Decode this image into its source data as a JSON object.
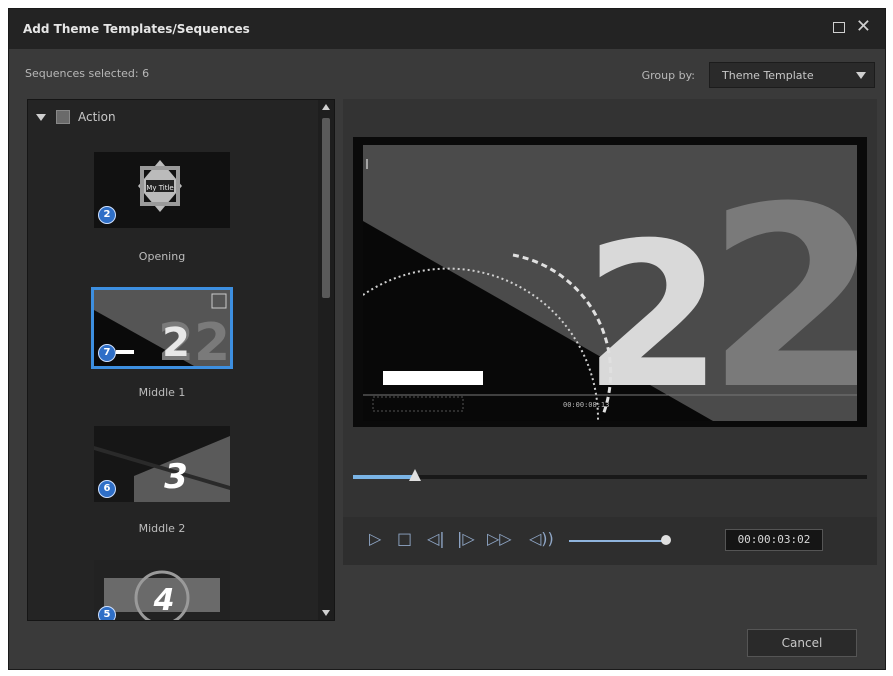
{
  "window": {
    "title": "Add Theme Templates/Sequences"
  },
  "header": {
    "sequences_selected": "Sequences selected: 6",
    "group_by_label": "Group by:",
    "group_by_value": "Theme Template"
  },
  "list": {
    "group_name": "Action",
    "items": [
      {
        "label": "Opening",
        "badge": "2",
        "thumb_text": "My Title"
      },
      {
        "label": "Middle 1",
        "badge": "7",
        "thumb_text": "22"
      },
      {
        "label": "Middle 2",
        "badge": "6",
        "thumb_text": "3"
      },
      {
        "label": "",
        "badge": "5",
        "thumb_text": "4"
      }
    ]
  },
  "preview": {
    "big_number": "2",
    "small_timecode": "00:00:08:13",
    "progress": 0.12,
    "volume": 0.9
  },
  "player": {
    "timecode": "00:00:03:02",
    "icons": [
      "play-icon",
      "stop-icon",
      "prev-frame-icon",
      "next-frame-icon",
      "fast-forward-icon",
      "volume-icon"
    ]
  },
  "footer": {
    "cancel_label": "Cancel"
  },
  "colors": {
    "accent": "#3d8fe0",
    "badge": "#2f6fc7"
  }
}
